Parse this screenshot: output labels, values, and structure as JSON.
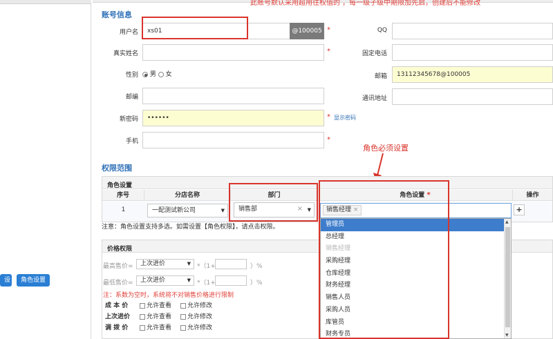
{
  "banner": "此账号默认采用超用往权值的 ，每一级子级中期限加先启，创建后不能修改",
  "left_panel": {
    "btn_settings": "设置",
    "btn_role_settings": "角色设置"
  },
  "account": {
    "section_title": "账号信息",
    "username_label": "用户名",
    "username_value": "xs01",
    "username_suffix": "@100005",
    "realname_label": "真实姓名",
    "gender_label": "性别",
    "gender_male": "男",
    "gender_female": "女",
    "postcode_label": "邮编",
    "new_password_label": "新密码",
    "new_password_value": "••••••",
    "show_password": "显示密码",
    "mobile_label": "手机",
    "qq_label": "QQ",
    "phone_label": "固定电话",
    "email_label": "邮箱",
    "email_value": "13112345678@100005",
    "address_label": "通讯地址",
    "required_mark": "*"
  },
  "annotation": {
    "role_required_note": "角色必须设置"
  },
  "permissions": {
    "section_title": "权限范围",
    "role_settings_title": "角色设置",
    "columns": {
      "index": "序号",
      "branch": "分店名称",
      "department": "部门",
      "role": "角色设置",
      "action": "操作"
    },
    "row": {
      "index": "1",
      "branch": "一配测试新公司",
      "department": "销售部",
      "role_tag": "销售经理",
      "add": "+"
    },
    "note": "注意：角色设置支持多选。如需设置【角色权限】，请点击权限。"
  },
  "role_dropdown": {
    "options": [
      {
        "label": "管理员",
        "state": "highlighted"
      },
      {
        "label": "总经理",
        "state": "normal"
      },
      {
        "label": "销售经理",
        "state": "disabled"
      },
      {
        "label": "采购经理",
        "state": "normal"
      },
      {
        "label": "仓库经理",
        "state": "normal"
      },
      {
        "label": "财务经理",
        "state": "normal"
      },
      {
        "label": "销售人员",
        "state": "normal"
      },
      {
        "label": "采购人员",
        "state": "normal"
      },
      {
        "label": "库管员",
        "state": "normal"
      },
      {
        "label": "财务专员",
        "state": "normal"
      }
    ]
  },
  "price": {
    "title": "价格权限",
    "max_price_label": "最高售价=",
    "min_price_label": "最低售价=",
    "base_option": "上次进价",
    "formula_mid": "*（1+",
    "formula_end": "）%",
    "note": "注：系数为空时，系统将不对销售价格进行限制",
    "rows": [
      {
        "label": "成 本 价",
        "view": "允许查看",
        "edit": "允许修改"
      },
      {
        "label": "上次进价",
        "view": "允许查看",
        "edit": "允许修改"
      },
      {
        "label": "调 拨 价",
        "view": "允许查看",
        "edit": "允许修改"
      }
    ]
  },
  "colors": {
    "accent_blue": "#3071b8",
    "highlight_red": "#d9342b",
    "selection_blue": "#3e7dcc",
    "yellow_field": "#fdfdd2"
  }
}
